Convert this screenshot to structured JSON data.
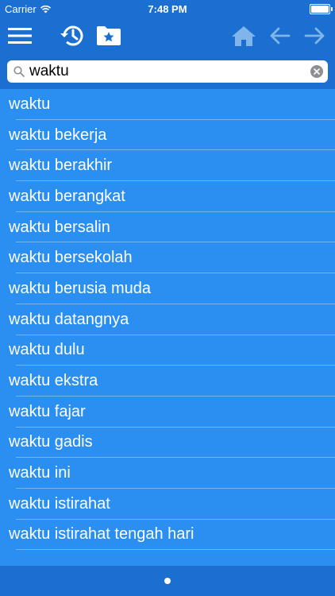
{
  "status": {
    "carrier": "Carrier",
    "time": "7:48 PM"
  },
  "toolbar": {
    "menu_icon": "hamburger-menu-icon",
    "history_icon": "history-icon",
    "favorites_icon": "star-folder-icon",
    "home_icon": "home-icon",
    "back_icon": "arrow-left-icon",
    "forward_icon": "arrow-right-icon"
  },
  "search": {
    "value": "waktu",
    "placeholder": ""
  },
  "list": {
    "items": [
      "waktu",
      "waktu bekerja",
      "waktu berakhir",
      "waktu berangkat",
      "waktu bersalin",
      "waktu bersekolah",
      "waktu berusia muda",
      "waktu datangnya",
      "waktu dulu",
      "waktu ekstra",
      "waktu fajar",
      "waktu gadis",
      "waktu ini",
      "waktu istirahat",
      "waktu istirahat tengah hari"
    ]
  },
  "colors": {
    "bar": "#1a6fd0",
    "list_bg": "#2a8ff0",
    "disabled_icon": "#7fb5ea"
  }
}
